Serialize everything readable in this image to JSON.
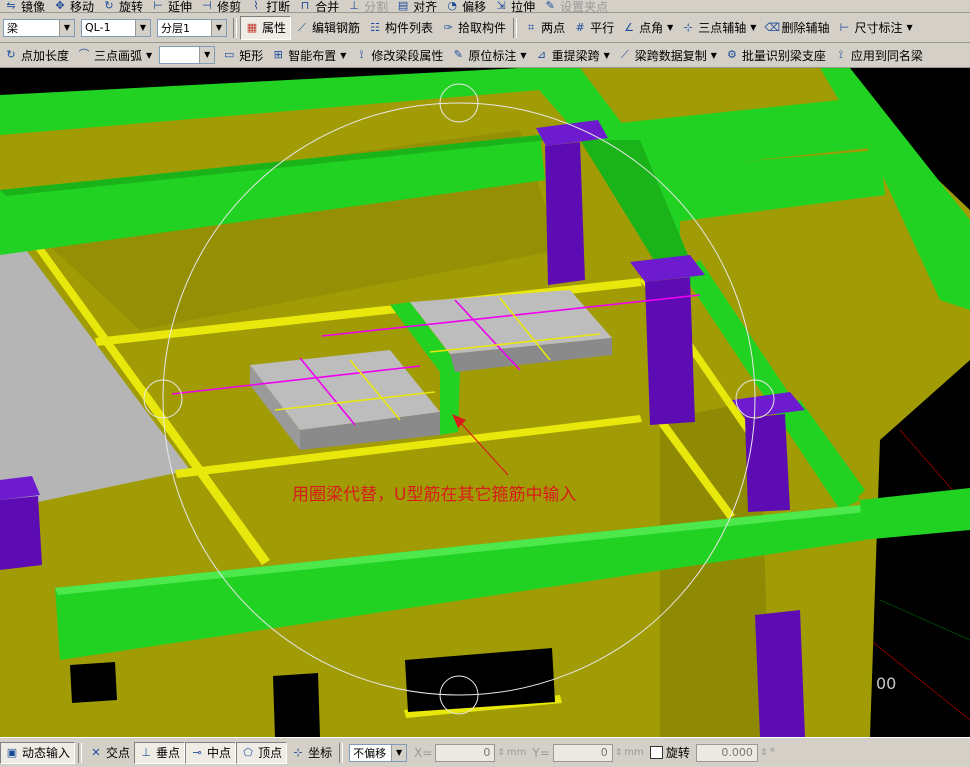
{
  "top_strip": {
    "items": [
      "镜像",
      "移动",
      "旋转",
      "延伸",
      "修剪",
      "打断",
      "合并",
      "分割",
      "对齐",
      "偏移",
      "拉伸",
      "设置夹点"
    ]
  },
  "toolbar1": {
    "type_value": "梁",
    "component_value": "QL-1",
    "layer_value": "分层1",
    "attribute": "属性",
    "edit_rebar": "编辑钢筋",
    "component_list": "构件列表",
    "pick_component": "拾取构件",
    "two_points": "两点",
    "parallel": "平行",
    "point_angle": "点角",
    "three_point_axis": "三点辅轴",
    "delete_aux_axis": "删除辅轴",
    "dimension": "尺寸标注"
  },
  "toolbar2": {
    "point_length": "点加长度",
    "three_point_arc": "三点画弧",
    "blank_combo": "",
    "rectangle": "矩形",
    "smart_layout": "智能布置",
    "modify_segment_attr": "修改梁段属性",
    "original_mark": "原位标注",
    "re_extract_span": "重提梁跨",
    "copy_span_data": "梁跨数据复制",
    "batch_identify_support": "批量识别梁支座",
    "apply_same_name": "应用到同名梁"
  },
  "viewport": {
    "annotation": "用圈梁代替，U型筋在其它箍筋中输入",
    "coord_text": "00"
  },
  "status": {
    "dynamic_input": "动态输入",
    "intersection": "交点",
    "perpendicular": "垂点",
    "midpoint": "中点",
    "vertex": "顶点",
    "coordinate": "坐标",
    "offset_mode": "不偏移",
    "x_label": "X=",
    "x_value": "0",
    "y_label": "Y=",
    "y_value": "0",
    "unit": "mm",
    "rotate": "旋转",
    "rotate_value": "0.000",
    "degree": "°"
  },
  "colors": {
    "wall": "#a19c06",
    "beam_green": "#22d222",
    "column_purple": "#5d0cb4",
    "yellow_line": "#e8e80c",
    "slab_gray": "#b5b5b5",
    "annotation_red": "#d81b1b",
    "rebar_magenta": "#f000f0"
  }
}
